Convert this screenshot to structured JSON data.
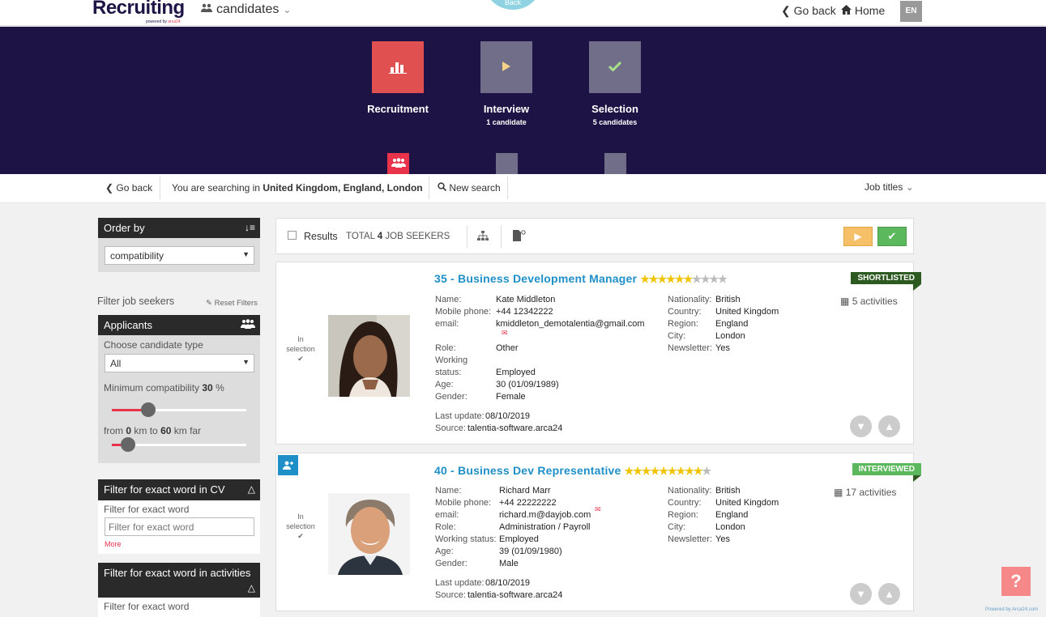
{
  "header": {
    "logo": "Recruiting",
    "logo_sub_prefix": "powered by ",
    "logo_sub_brand": "arca24",
    "module": "candidates",
    "back_circle_label": "Back",
    "go_back": "Go back",
    "home": "Home",
    "lang": "EN"
  },
  "pipeline": [
    {
      "title": "Recruitment",
      "sub": "",
      "color": "#d9534f",
      "icon": "bar-chart-icon"
    },
    {
      "title": "Interview",
      "sub": "1 candidate",
      "color": "#716e8a",
      "icon": "play-icon"
    },
    {
      "title": "Selection",
      "sub": "5 candidates",
      "color": "#716e8a",
      "icon": "check-icon"
    }
  ],
  "searchbar": {
    "go_back": "Go back",
    "searching_prefix": "You are searching in ",
    "location": "United Kingdom, England, London",
    "new_search": "New search",
    "job_titles": "Job titles"
  },
  "sidebar": {
    "order_by_title": "Order by",
    "order_by_value": "compatibility",
    "filter_title": "Filter job seekers",
    "reset_filters": "Reset Filters",
    "applicants_title": "Applicants",
    "candidate_type_label": "Choose candidate type",
    "candidate_type_value": "All",
    "min_compat_label": "Minimum compatibility",
    "min_compat_value": "30",
    "min_compat_unit": "%",
    "min_compat_fraction": 0.3,
    "distance_from_label": "from",
    "distance_from": "0",
    "distance_to_label": "km to",
    "distance_to": "60",
    "distance_unit": "km far",
    "exact_cv_title": "Filter for exact word in CV",
    "exact_cv_label": "Filter for exact word",
    "exact_cv_placeholder": "Filter for exact word",
    "more": "More",
    "exact_act_title": "Filter for exact word in activities",
    "exact_act_label": "Filter for exact word"
  },
  "results": {
    "label": "Results",
    "total_prefix": "TOTAL",
    "total": "4",
    "total_suffix": "JOB SEEKERS"
  },
  "candidates": [
    {
      "title": "35 - Business Development Manager",
      "stars_on": 6,
      "stars_total": 10,
      "badge": "SHORTLISTED",
      "badge_color": "#2d5a20",
      "activities": "5 activities",
      "in_selection": "In selection",
      "name_label": "Name:",
      "name": "Kate Middleton",
      "phone_label": "Mobile phone:",
      "phone": "+44 12342222",
      "email_label": "email:",
      "email": "kmiddleton_demotalentia@gmail.com",
      "role_label": "Role:",
      "role": "Other",
      "working_label_1": "Working",
      "working_label_2": "status:",
      "working": "Employed",
      "age_label": "Age:",
      "age": "30 (01/09/1989)",
      "gender_label": "Gender:",
      "gender": "Female",
      "last_update_label": "Last update:",
      "last_update": "08/10/2019",
      "source_label": "Source:",
      "source": "talentia-software.arca24",
      "nationality_label": "Nationality:",
      "nationality": "British",
      "country_label": "Country:",
      "country": "United Kingdom",
      "region_label": "Region:",
      "region": "England",
      "city_label": "City:",
      "city": "London",
      "newsletter_label": "Newsletter:",
      "newsletter": "Yes"
    },
    {
      "title": "40 - Business Dev Representative",
      "stars_on": 9,
      "stars_total": 10,
      "badge": "INTERVIEWED",
      "badge_color": "#5cb85c",
      "activities": "17 activities",
      "in_selection": "In selection",
      "name_label": "Name:",
      "name": "Richard Marr",
      "phone_label": "Mobile phone:",
      "phone": "+44 22222222",
      "email_label": "email:",
      "email": "richard.m@dayjob.com",
      "role_label": "Role:",
      "role": "Administration / Payroll",
      "working_label": "Working status:",
      "working": "Employed",
      "age_label": "Age:",
      "age": "39 (01/09/1980)",
      "gender_label": "Gender:",
      "gender": "Male",
      "last_update_label": "Last update:",
      "last_update": "08/10/2019",
      "source_label": "Source:",
      "source": "talentia-software.arca24",
      "nationality_label": "Nationality:",
      "nationality": "British",
      "country_label": "Country:",
      "country": "United Kingdom",
      "region_label": "Region:",
      "region": "England",
      "city_label": "City:",
      "city": "London",
      "newsletter_label": "Newsletter:",
      "newsletter": "Yes"
    }
  ],
  "help": "?",
  "powered_by": "Powered by Arca24.com"
}
